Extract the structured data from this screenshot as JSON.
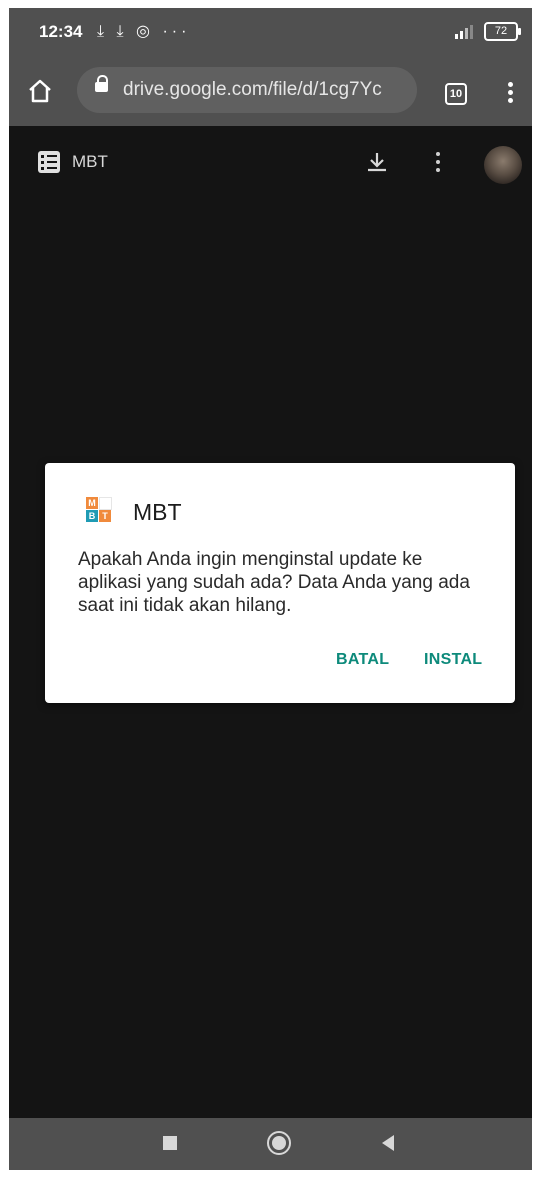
{
  "status_bar": {
    "time": "12:34",
    "notification_icons": "⤓ ⤓ ◎ ···",
    "battery": "72"
  },
  "browser": {
    "url": "drive.google.com/file/d/1cg7Yc",
    "tab_count": "10"
  },
  "drive_viewer": {
    "file_title": "MBT"
  },
  "dialog": {
    "app_name": "MBT",
    "app_icon_letters": [
      "M",
      "B",
      "T"
    ],
    "message": "Apakah Anda ingin menginstal update ke aplikasi yang sudah ada? Data Anda yang ada saat ini tidak akan hilang.",
    "cancel_label": "BATAL",
    "install_label": "INSTAL",
    "accent_color": "#0d8a7b"
  }
}
